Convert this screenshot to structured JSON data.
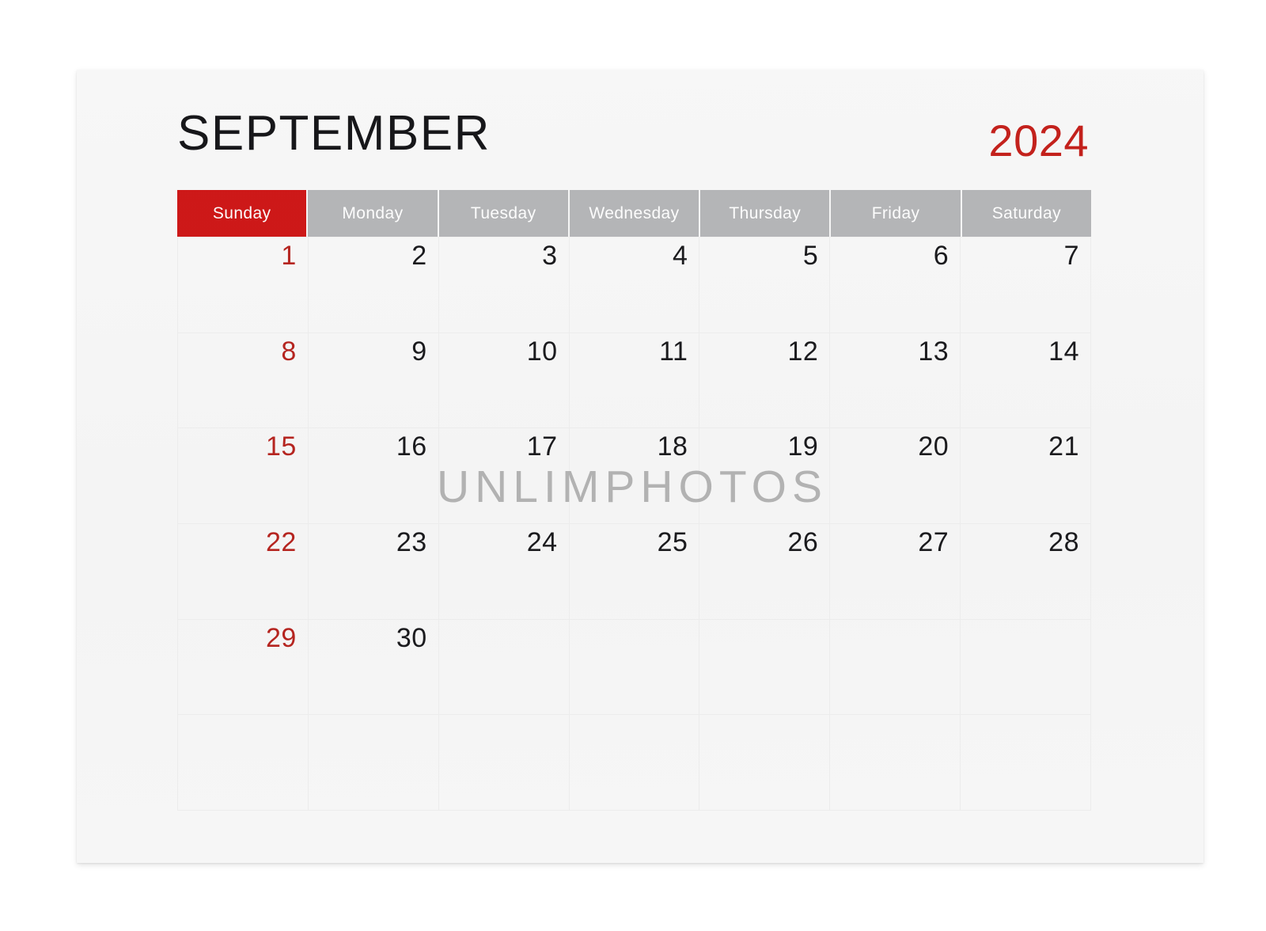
{
  "calendar": {
    "month": "SEPTEMBER",
    "year": "2024",
    "colors": {
      "sunday_header_bg": "#ce1313",
      "weekday_header_bg": "#b4b5b7",
      "year_text": "#c3211c",
      "sunday_date_text": "#b52520",
      "weekday_date_text": "#1b1b1e",
      "page_bg": "#f5f5f5",
      "canvas_bg": "#ffffff",
      "grid_line": "#ececec"
    },
    "weekdays": [
      {
        "label": "Sunday",
        "highlight": true
      },
      {
        "label": "Monday",
        "highlight": false
      },
      {
        "label": "Tuesday",
        "highlight": false
      },
      {
        "label": "Wednesday",
        "highlight": false
      },
      {
        "label": "Thursday",
        "highlight": false
      },
      {
        "label": "Friday",
        "highlight": false
      },
      {
        "label": "Saturday",
        "highlight": false
      }
    ],
    "weeks": [
      [
        {
          "date": "1",
          "sunday": true
        },
        {
          "date": "2",
          "sunday": false
        },
        {
          "date": "3",
          "sunday": false
        },
        {
          "date": "4",
          "sunday": false
        },
        {
          "date": "5",
          "sunday": false
        },
        {
          "date": "6",
          "sunday": false
        },
        {
          "date": "7",
          "sunday": false
        }
      ],
      [
        {
          "date": "8",
          "sunday": true
        },
        {
          "date": "9",
          "sunday": false
        },
        {
          "date": "10",
          "sunday": false
        },
        {
          "date": "11",
          "sunday": false
        },
        {
          "date": "12",
          "sunday": false
        },
        {
          "date": "13",
          "sunday": false
        },
        {
          "date": "14",
          "sunday": false
        }
      ],
      [
        {
          "date": "15",
          "sunday": true
        },
        {
          "date": "16",
          "sunday": false
        },
        {
          "date": "17",
          "sunday": false
        },
        {
          "date": "18",
          "sunday": false
        },
        {
          "date": "19",
          "sunday": false
        },
        {
          "date": "20",
          "sunday": false
        },
        {
          "date": "21",
          "sunday": false
        }
      ],
      [
        {
          "date": "22",
          "sunday": true
        },
        {
          "date": "23",
          "sunday": false
        },
        {
          "date": "24",
          "sunday": false
        },
        {
          "date": "25",
          "sunday": false
        },
        {
          "date": "26",
          "sunday": false
        },
        {
          "date": "27",
          "sunday": false
        },
        {
          "date": "28",
          "sunday": false
        }
      ],
      [
        {
          "date": "29",
          "sunday": true
        },
        {
          "date": "30",
          "sunday": false
        },
        {
          "date": "",
          "sunday": false
        },
        {
          "date": "",
          "sunday": false
        },
        {
          "date": "",
          "sunday": false
        },
        {
          "date": "",
          "sunday": false
        },
        {
          "date": "",
          "sunday": false
        }
      ],
      [
        {
          "date": "",
          "sunday": true
        },
        {
          "date": "",
          "sunday": false
        },
        {
          "date": "",
          "sunday": false
        },
        {
          "date": "",
          "sunday": false
        },
        {
          "date": "",
          "sunday": false
        },
        {
          "date": "",
          "sunday": false
        },
        {
          "date": "",
          "sunday": false
        }
      ]
    ]
  },
  "watermark": {
    "text": "UNLIMPHOTOS"
  }
}
